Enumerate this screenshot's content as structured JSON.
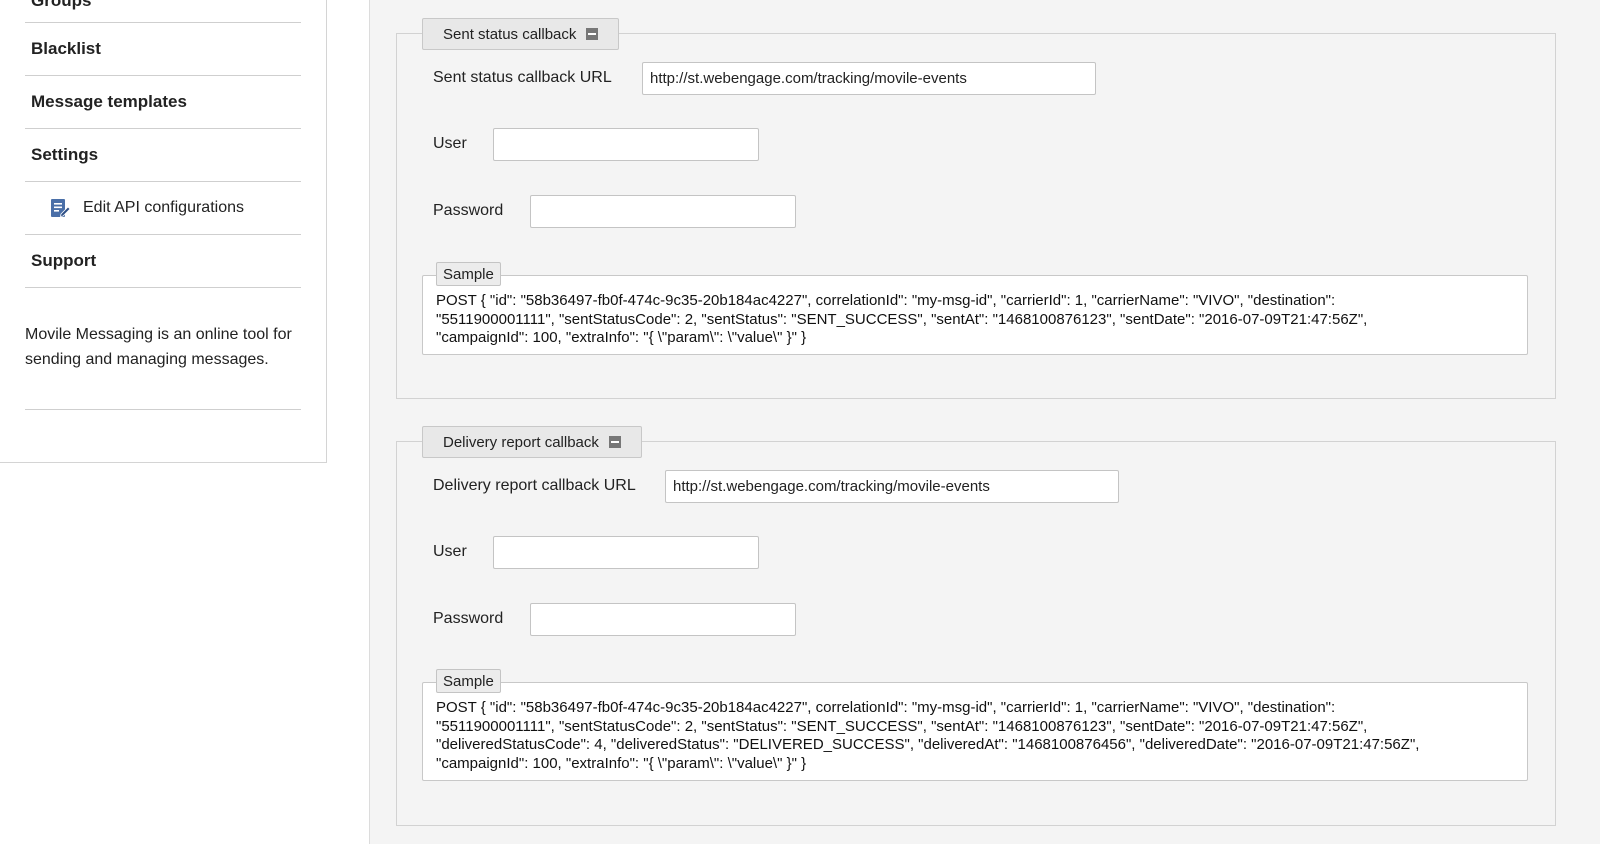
{
  "sidebar": {
    "items": [
      {
        "label": "Groups"
      },
      {
        "label": "Blacklist"
      },
      {
        "label": "Message templates"
      },
      {
        "label": "Settings"
      },
      {
        "label": "Edit API configurations",
        "icon": "edit-document-icon"
      },
      {
        "label": "Support"
      }
    ],
    "description": "Movile Messaging is an online tool for sending and managing messages."
  },
  "sent_status": {
    "legend": "Sent status callback",
    "url_label": "Sent status callback URL",
    "url_value": "http://st.webengage.com/tracking/movile-events",
    "user_label": "User",
    "user_value": "",
    "password_label": "Password",
    "password_value": "",
    "sample_label": "Sample",
    "sample_text": "POST { \"id\": \"58b36497-fb0f-474c-9c35-20b184ac4227\", correlationId\": \"my-msg-id\", \"carrierId\": 1, \"carrierName\": \"VIVO\", \"destination\":\n\"5511900001111\", \"sentStatusCode\": 2, \"sentStatus\": \"SENT_SUCCESS\", \"sentAt\": \"1468100876123\", \"sentDate\": \"2016-07-09T21:47:56Z\",\n\"campaignId\": 100, \"extraInfo\": \"{ \\\"param\\\": \\\"value\\\" }\" }"
  },
  "delivery_report": {
    "legend": "Delivery report callback",
    "url_label": "Delivery report callback URL",
    "url_value": "http://st.webengage.com/tracking/movile-events",
    "user_label": "User",
    "user_value": "",
    "password_label": "Password",
    "password_value": "",
    "sample_label": "Sample",
    "sample_text": "POST { \"id\": \"58b36497-fb0f-474c-9c35-20b184ac4227\", correlationId\": \"my-msg-id\", \"carrierId\": 1, \"carrierName\": \"VIVO\", \"destination\":\n\"5511900001111\", \"sentStatusCode\": 2, \"sentStatus\": \"SENT_SUCCESS\", \"sentAt\": \"1468100876123\", \"sentDate\": \"2016-07-09T21:47:56Z\",\n\"deliveredStatusCode\": 4, \"deliveredStatus\": \"DELIVERED_SUCCESS\", \"deliveredAt\": \"1468100876456\", \"deliveredDate\": \"2016-07-09T21:47:56Z\",\n\"campaignId\": 100, \"extraInfo\": \"{ \\\"param\\\": \\\"value\\\" }\" }"
  },
  "colors": {
    "main_bg": "#f4f4f4",
    "legend_bg": "#e8e8e8",
    "icon_blue": "#4a6fa8"
  }
}
